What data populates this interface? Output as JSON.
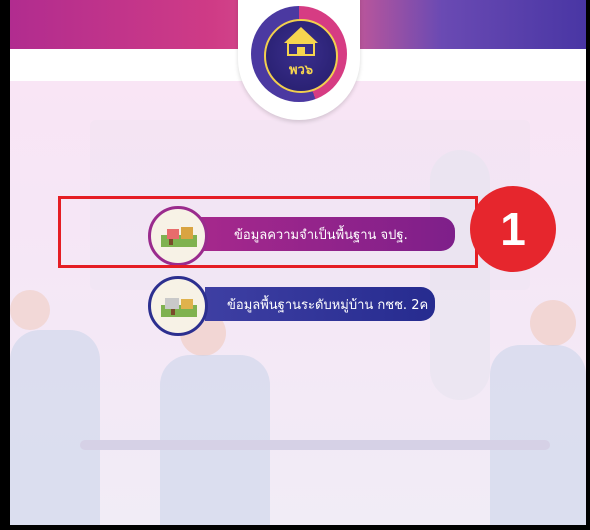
{
  "logo": {
    "text": "พว๖"
  },
  "menu": {
    "item1_label": "ข้อมูลความจำเป็นพื้นฐาน  จปฐ.",
    "item2_label": "ข้อมูลพื้นฐานระดับหมู่บ้าน  กชช. 2ค"
  },
  "annotation": {
    "badge_number": "1"
  },
  "colors": {
    "header_magenta": "#b12c8f",
    "header_indigo": "#4936a4",
    "button1": "#9b2389",
    "button2": "#2f339a",
    "highlight": "#e51d24"
  },
  "icons": [
    "village-map-icon",
    "village-map-icon"
  ]
}
